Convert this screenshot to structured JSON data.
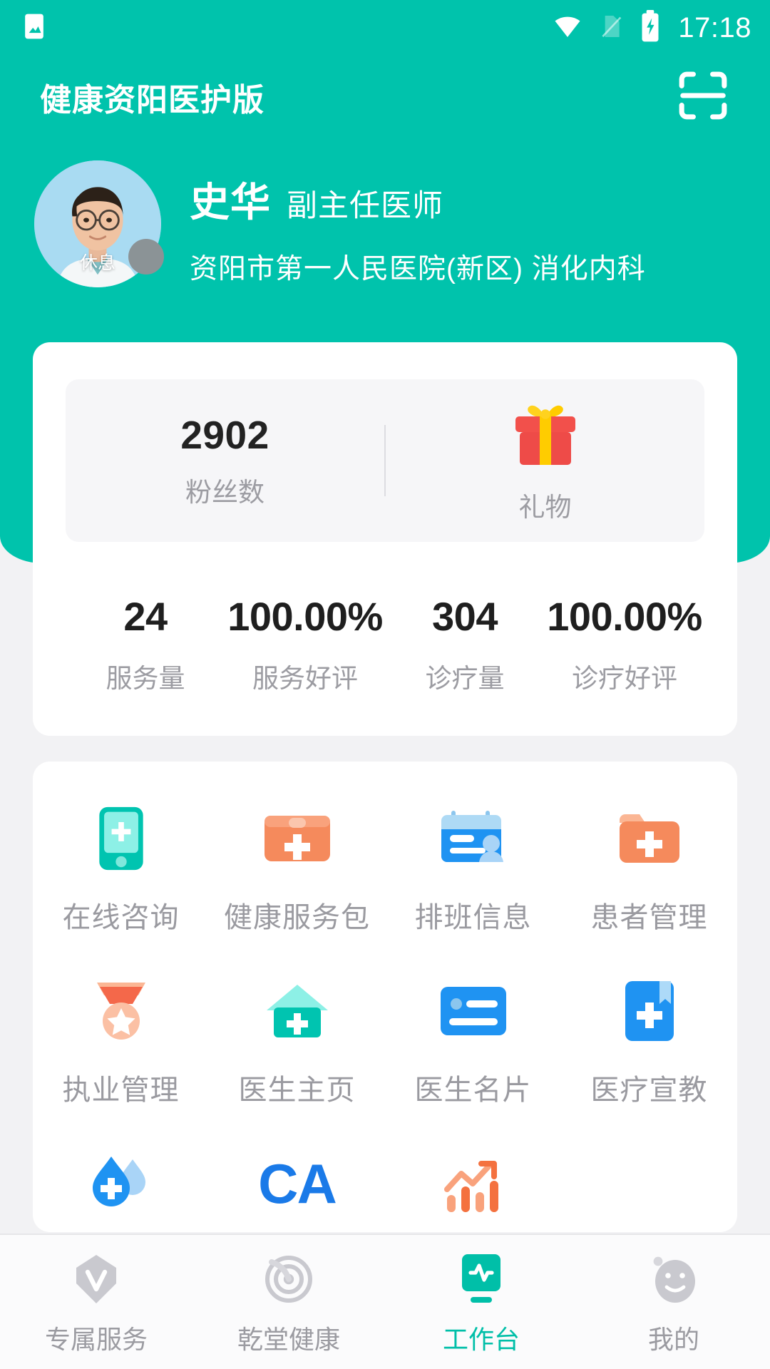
{
  "statusbar": {
    "time": "17:18",
    "icons": [
      "image-icon",
      "wifi-icon",
      "no-sim-icon",
      "battery-charging-icon"
    ]
  },
  "appbar": {
    "title": "健康资阳医护版",
    "scan_icon": "scan-icon"
  },
  "profile": {
    "name": "史华",
    "title": "副主任医师",
    "organization": "资阳市第一人民医院(新区)  消化内科",
    "status_badge": "休息",
    "avatar_icon": "doctor-avatar"
  },
  "stats_card": {
    "fans": {
      "value": "2902",
      "label": "粉丝数"
    },
    "gift": {
      "label": "礼物",
      "icon": "gift-icon"
    },
    "metrics": [
      {
        "value": "24",
        "label": "服务量"
      },
      {
        "value": "100.00%",
        "label": "服务好评"
      },
      {
        "value": "304",
        "label": "诊疗量"
      },
      {
        "value": "100.00%",
        "label": "诊疗好评"
      }
    ]
  },
  "grid": {
    "items": [
      {
        "label": "在线咨询",
        "icon": "phone-plus-icon"
      },
      {
        "label": "健康服务包",
        "icon": "medical-kit-icon"
      },
      {
        "label": "排班信息",
        "icon": "schedule-card-icon"
      },
      {
        "label": "患者管理",
        "icon": "folder-plus-icon"
      },
      {
        "label": "执业管理",
        "icon": "medal-icon"
      },
      {
        "label": "医生主页",
        "icon": "clinic-home-icon"
      },
      {
        "label": "医生名片",
        "icon": "name-card-icon"
      },
      {
        "label": "医疗宣教",
        "icon": "book-plus-icon"
      },
      {
        "label": "",
        "icon": "blood-drop-icon"
      },
      {
        "label": "",
        "icon": "ca-icon",
        "text": "CA"
      },
      {
        "label": "",
        "icon": "chart-growth-icon"
      },
      {
        "label": "",
        "icon": ""
      }
    ]
  },
  "tabbar": {
    "items": [
      {
        "label": "专属服务",
        "icon": "diamond-v-icon",
        "active": false
      },
      {
        "label": "乾堂健康",
        "icon": "spiral-icon",
        "active": false
      },
      {
        "label": "工作台",
        "icon": "monitor-pulse-icon",
        "active": true
      },
      {
        "label": "我的",
        "icon": "face-icon",
        "active": false
      }
    ]
  },
  "colors": {
    "brand_teal": "#00c3ac",
    "active_tab": "#00bfa8",
    "page_bg": "#f2f2f4",
    "card_bg": "#ffffff",
    "muted_text": "#9a9aa0"
  }
}
